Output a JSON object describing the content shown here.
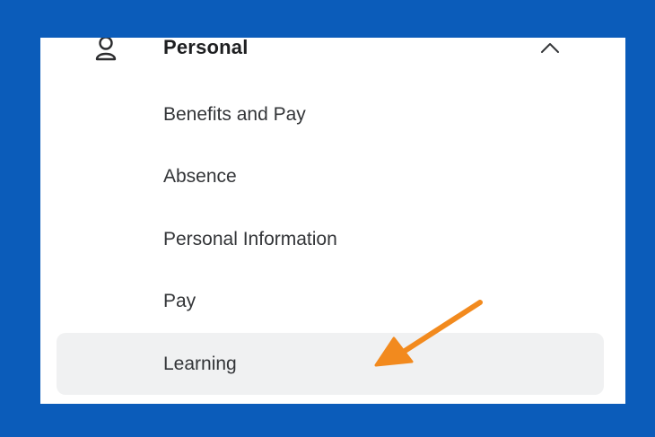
{
  "section": {
    "title": "Personal",
    "icon": "person-icon",
    "toggle_icon": "chevron-up-icon",
    "expanded": true
  },
  "menu": {
    "items": [
      {
        "label": "Benefits and Pay",
        "active": false
      },
      {
        "label": "Absence",
        "active": false
      },
      {
        "label": "Personal Information",
        "active": false
      },
      {
        "label": "Pay",
        "active": false
      },
      {
        "label": "Learning",
        "active": true
      }
    ]
  },
  "colors": {
    "frame": "#0b5cba",
    "panel": "#ffffff",
    "active_item": "#f0f1f2",
    "annotation_arrow": "#f28a1e"
  }
}
